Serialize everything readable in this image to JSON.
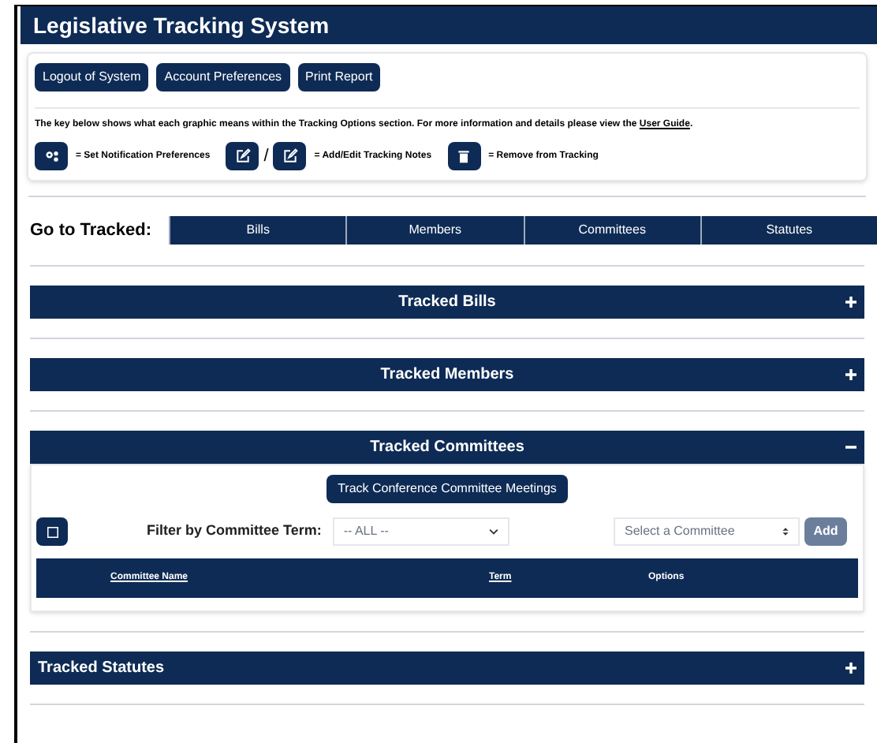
{
  "window": {
    "title": "Legislative Tracking System"
  },
  "toolbar": {
    "buttons": [
      "Logout of System",
      "Account Preferences",
      "Print Report"
    ]
  },
  "key": {
    "text": "The key below shows what each graphic means within the Tracking Options section. For more information and details please view the ",
    "link": "User Guide",
    "end": ".",
    "items": [
      {
        "kind": "gears",
        "label": "= Set Notification Preferences"
      },
      {
        "kind": "notes",
        "separator": "/",
        "label": "= Add/Edit Tracking Notes"
      },
      {
        "kind": "trash",
        "label": "= Remove from Tracking"
      }
    ]
  },
  "go_to": {
    "label": "Go to Tracked:",
    "tabs": [
      "Bills",
      "Members",
      "Committees",
      "Statutes"
    ]
  },
  "sections": [
    {
      "title": "Tracked Bills",
      "kind": "center",
      "expanded": false
    },
    {
      "title": "Tracked Members",
      "kind": "center",
      "expanded": false
    },
    {
      "title": "Tracked Committees",
      "kind": "center",
      "expanded": true,
      "content": {
        "conference_button": "Track Conference Committee Meetings",
        "select_all_checked": false,
        "filter_label": "Filter by Committee Term:",
        "term_select": {
          "value": "-- ALL --"
        },
        "committee_select": {
          "value": "Select a Committee"
        },
        "add_button": {
          "label": "Add",
          "disabled": true
        },
        "columns": [
          {
            "label": "Committee Name",
            "link": true
          },
          {
            "label": "Term",
            "link": true
          },
          {
            "label": "Options",
            "link": false
          }
        ]
      }
    },
    {
      "title": "Tracked Statutes",
      "kind": "left",
      "expanded": false
    }
  ]
}
